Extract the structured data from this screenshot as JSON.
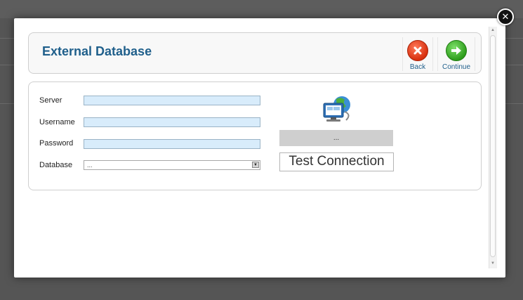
{
  "modal": {
    "close_icon": "close-icon",
    "header": {
      "title": "External Database",
      "buttons": [
        {
          "label": "Back",
          "icon": "cancel-icon",
          "color": "#d8300f"
        },
        {
          "label": "Continue",
          "icon": "arrow-right-icon",
          "color": "#2e9d1c"
        }
      ]
    },
    "form": {
      "server": {
        "label": "Server",
        "value": ""
      },
      "username": {
        "label": "Username",
        "value": ""
      },
      "password": {
        "label": "Password",
        "value": ""
      },
      "database": {
        "label": "Database",
        "selected": "..."
      }
    },
    "connection": {
      "icon": "network-computer-icon",
      "status": "...",
      "test_button": "Test Connection"
    }
  },
  "colors": {
    "title": "#1f5f8b",
    "input_bg": "#d8ecfb",
    "backdrop": "#555555"
  }
}
